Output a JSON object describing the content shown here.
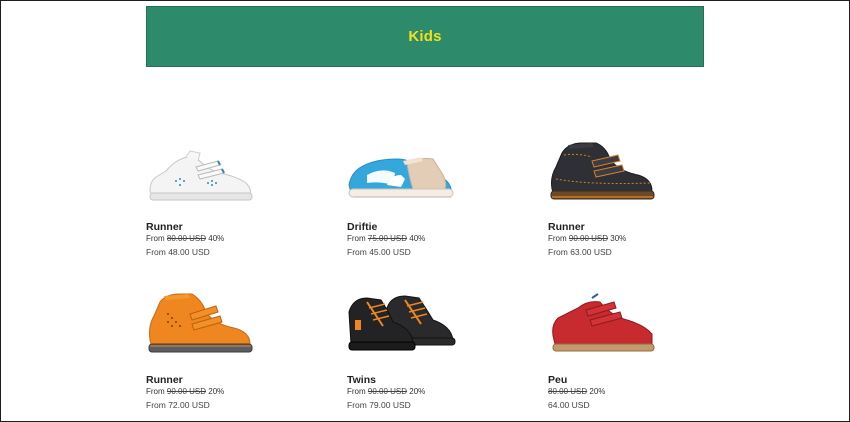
{
  "banner": {
    "title": "Kids"
  },
  "products": [
    {
      "name": "Runner",
      "from_label": "From",
      "original_price": "80.00  USD",
      "discount": "40%",
      "sale_price": "From 48.00 USD"
    },
    {
      "name": "Driftie",
      "from_label": "From",
      "original_price": "75.00  USD",
      "discount": "40%",
      "sale_price": "From 45.00 USD"
    },
    {
      "name": "Runner",
      "from_label": "From",
      "original_price": "90.00  USD",
      "discount": "30%",
      "sale_price": "From 63.00 USD"
    },
    {
      "name": "Runner",
      "from_label": "From",
      "original_price": "90.00  USD",
      "discount": "20%",
      "sale_price": "From 72.00 USD"
    },
    {
      "name": "Twins",
      "from_label": "From",
      "original_price": "90.00  USD",
      "discount": "20%",
      "sale_price": "From 79.00 USD"
    },
    {
      "name": "Peu",
      "from_label": "",
      "original_price": "80.00  USD",
      "discount": "20%",
      "sale_price": "64.00 USD"
    }
  ],
  "colors": {
    "banner": "#2d8a6b",
    "banner_text": "#f2e11a"
  }
}
